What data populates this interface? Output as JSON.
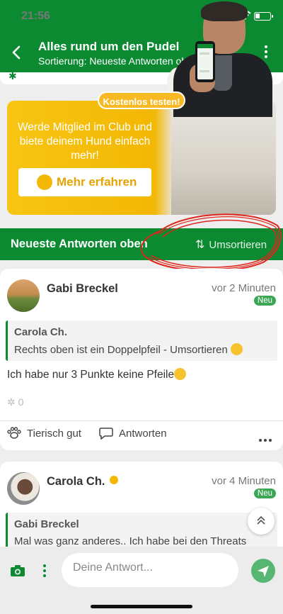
{
  "status_bar": {
    "time": "21:56"
  },
  "app_bar": {
    "title": "Alles rund um den Pudel",
    "subtitle": "Sortierung: Neueste Antworten oben"
  },
  "banner": {
    "badge": "Kostenlos testen!",
    "headline": "Werde Mitglied im Club und biete deinem Hund einfach mehr!",
    "cta_label": "Mehr erfahren",
    "accent_color": "#f3b705"
  },
  "sort_bar": {
    "label": "Neueste Antworten oben",
    "button_label": "Umsortieren"
  },
  "posts": [
    {
      "author": "Gabi Breckel",
      "time": "vor 2 Minuten",
      "badge": "Neu",
      "quote_author": "Carola Ch.",
      "quote_text": "Rechts oben ist ein Doppelpfeil - Umsortieren",
      "text": "Ich habe nur 3 Punkte keine Pfeile",
      "likes": "0",
      "action_like": "Tierisch gut",
      "action_reply": "Antworten"
    },
    {
      "author": "Carola Ch.",
      "time": "vor 4 Minuten",
      "badge": "Neu",
      "quote_author": "Gabi Breckel",
      "quote_text": "Mal was ganz anderes.. Ich habe bei den Threats"
    }
  ],
  "composer": {
    "placeholder": "Deine Antwort..."
  },
  "colors": {
    "brand_green": "#0b8a32",
    "annotation_red": "#e0241b"
  }
}
